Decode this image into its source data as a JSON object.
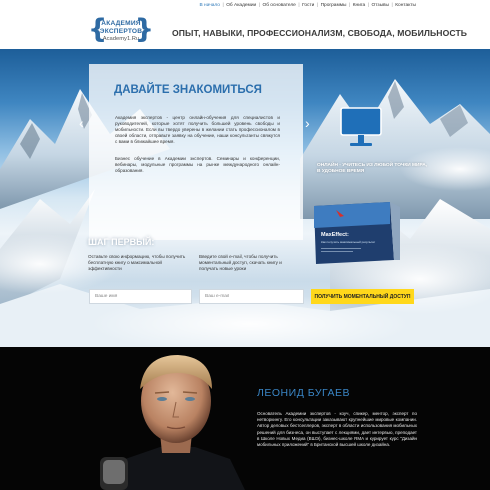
{
  "nav": {
    "items": [
      {
        "label": "В начало",
        "active": true
      },
      {
        "label": "Об Академии",
        "active": false
      },
      {
        "label": "Об основателе",
        "active": false
      },
      {
        "label": "Гости",
        "active": false
      },
      {
        "label": "Программы",
        "active": false
      },
      {
        "label": "Книга",
        "active": false
      },
      {
        "label": "Отзывы",
        "active": false
      },
      {
        "label": "Контакты",
        "active": false
      }
    ],
    "active_color": "#2e79b9"
  },
  "header": {
    "logo": {
      "line1": "АКАДЕМИЯ",
      "line2": "ЭКСПЕРТОВ",
      "line3": "Academy1.Ru"
    },
    "slogan": "ОПЫТ, НАВЫКИ, ПРОФЕССИОНАЛИЗМ, СВОБОДА, МОБИЛЬНОСТЬ"
  },
  "hero": {
    "arrow_left": "‹",
    "arrow_right": "›",
    "intro": {
      "title": "ДАВАЙТЕ ЗНАКОМИТЬСЯ",
      "p1": "Академия экспертов - центр онлайн-обучения для специалистов и руководителей, которые хотят получить большей уровень свободы и мобильности. Если вы твердо уверены в желании стать профессионалом в своей области, отправьте заявку на обучение, наши консультанты свяжутся с вами в ближайшее время.",
      "p2": "Бизнес обучение в Академии экспертов. Семинары и конференции, вебинары, модульные программы на рынке международного онлайн-образования."
    },
    "online_text": "ОНЛАЙН - УЧИТЕСЬ ИЗ ЛЮБОЙ ТОЧКИ МИРА, В УДОБНОЕ ВРЕМЯ",
    "book": {
      "title": "MaxEffect:",
      "subtitle": "Как получить максимальный результат"
    },
    "form": {
      "step_title": "ШАГ ПЕРВЫЙ:",
      "hint_name": "Оставьте свою информацию, чтобы получить бесплатную книгу о максимальной эффективности",
      "hint_email": "Введите свой e-mail, чтобы получить моментальный доступ, скачать книгу и получать новые уроки",
      "name_placeholder": "Ваше имя",
      "email_placeholder": "Ваш e-mail",
      "cta_label": "ПОЛУЧИТЬ МОМЕНТАЛЬНЫЙ ДОСТУП",
      "cta_color": "#ffd81b"
    }
  },
  "author": {
    "name": "ЛЕОНИД БУГАЕВ",
    "bio": "Основатель Академии экспертов - коуч, спикер, ментор, эксперт по нетворкингу. Его консультации заказывают крупнейшие мировые компании. Автор деловых бестселлеров, эксперт в области использования мобильных решений для бизнеса, он выступает с лекциями, дает интервью, преподает в Школе Новых Медиа (ВШЭ), бизнес-школе RMA и курирует курс \"Дизайн мобильных приложений\" в Британской высшей школе дизайна.",
    "name_color": "#3a86c6"
  }
}
